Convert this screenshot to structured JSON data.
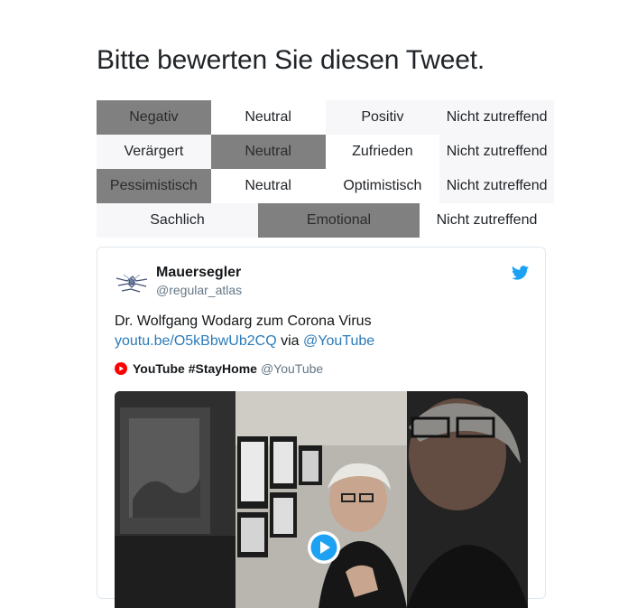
{
  "page": {
    "title": "Bitte bewerten Sie diesen Tweet."
  },
  "rating": {
    "rows": [
      {
        "options": [
          "Negativ",
          "Neutral",
          "Positiv",
          "Nicht zutreffend"
        ],
        "selected": 0
      },
      {
        "options": [
          "Verärgert",
          "Neutral",
          "Zufrieden",
          "Nicht zutreffend"
        ],
        "selected": 1
      },
      {
        "options": [
          "Pessimistisch",
          "Neutral",
          "Optimistisch",
          "Nicht zutreffend"
        ],
        "selected": 0
      },
      {
        "options": [
          "Sachlich",
          "Emotional",
          "Nicht zutreffend"
        ],
        "selected": 1
      }
    ]
  },
  "tweet": {
    "user_name": "Mauersegler",
    "user_handle": "@regular_atlas",
    "text_line1": "Dr. Wolfgang Wodarg zum Corona Virus",
    "link": "youtu.be/O5kBbwUb2CQ",
    "via": "via",
    "mention": "@YouTube",
    "card_name": "YouTube #StayHome",
    "card_handle": "@YouTube"
  },
  "colors": {
    "selected": "#808080",
    "link": "#2b7bb9",
    "twitter_blue": "#1da1f2",
    "youtube_red": "#ff0000"
  },
  "icons": {
    "twitter": "twitter-bird-icon",
    "youtube": "youtube-icon",
    "play": "play-icon"
  }
}
